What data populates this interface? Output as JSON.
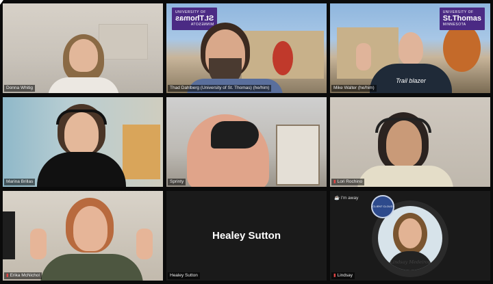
{
  "participants": [
    {
      "name": "Donna Whitig",
      "muted": false
    },
    {
      "name": "Thad Dahlberg (University of St. Thomas) (he/him)",
      "muted": false
    },
    {
      "name": "Mike Walter (he/him)",
      "muted": false
    },
    {
      "name": "Marina Brillas",
      "muted": false
    },
    {
      "name": "Sprinty",
      "muted": false
    },
    {
      "name": "Lori Rochino",
      "muted": true
    },
    {
      "name": "Erika McNichol",
      "muted": true
    },
    {
      "name": "Healey Sutton",
      "muted": false,
      "display_text": "Healey Sutton"
    },
    {
      "name": "Lindsay",
      "muted": true,
      "status": "I'm away",
      "badge_text": "CLIENT CLOUD",
      "avatar_caption": "Lindsay Medeiros"
    }
  ],
  "logos": {
    "university": "UNIVERSITY OF",
    "name": "St.Thomas",
    "city_mirrored": "MINNESOTA",
    "city": "MINNESOTA"
  },
  "shirt_text": "Trail blazer",
  "colors": {
    "active_border": "#c9d43a",
    "muted_icon": "#e64545",
    "logo_purple": "#4b2a84"
  }
}
